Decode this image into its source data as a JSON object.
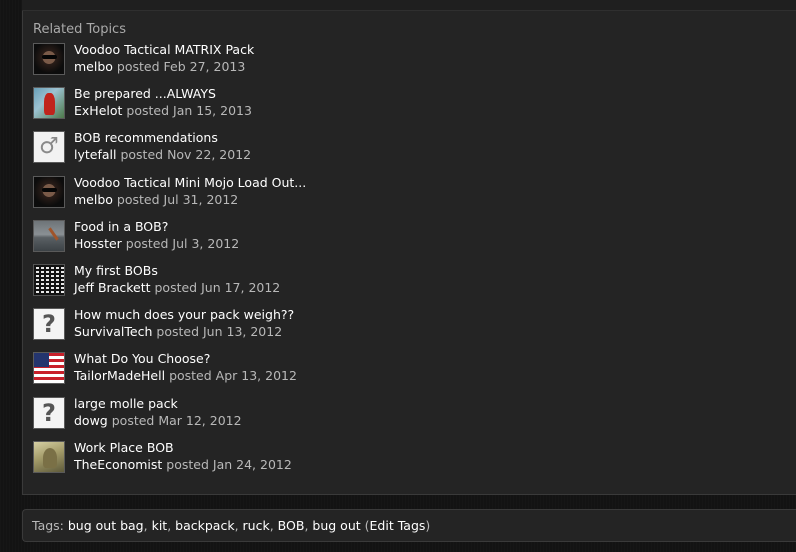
{
  "related": {
    "heading": "Related Topics",
    "posted_word": "posted",
    "topics": [
      {
        "title": "Voodoo Tactical MATRIX Pack",
        "author": "melbo",
        "date": "Feb 27, 2013",
        "avatar": "sunglasses-face-avatar"
      },
      {
        "title": "Be prepared ...ALWAYS",
        "author": "ExHelot",
        "date": "Jan 15, 2013",
        "avatar": "red-figure-avatar"
      },
      {
        "title": "BOB recommendations",
        "author": "lytefall",
        "date": "Nov 22, 2012",
        "avatar": "male-symbol-avatar",
        "glyph": "♂"
      },
      {
        "title": "Voodoo Tactical Mini Mojo Load Out...",
        "author": "melbo",
        "date": "Jul 31, 2012",
        "avatar": "sunglasses-face-avatar"
      },
      {
        "title": "Food in a BOB?",
        "author": "Hosster",
        "date": "Jul 3, 2012",
        "avatar": "water-landscape-avatar"
      },
      {
        "title": "My first BOBs",
        "author": "Jeff Brackett",
        "date": "Jun 17, 2012",
        "avatar": "qr-code-avatar"
      },
      {
        "title": "How much does your pack weigh??",
        "author": "SurvivalTech",
        "date": "Jun 13, 2012",
        "avatar": "question-mark-avatar",
        "glyph": "?"
      },
      {
        "title": "What Do You Choose?",
        "author": "TailorMadeHell",
        "date": "Apr 13, 2012",
        "avatar": "us-flag-avatar"
      },
      {
        "title": "large molle pack",
        "author": "dowg",
        "date": "Mar 12, 2012",
        "avatar": "question-mark-avatar",
        "glyph": "?"
      },
      {
        "title": "Work Place BOB",
        "author": "TheEconomist",
        "date": "Jan 24, 2012",
        "avatar": "soldier-avatar"
      }
    ]
  },
  "tags": {
    "label": "Tags:",
    "items": [
      "bug out bag",
      "kit",
      "backpack",
      "ruck",
      "BOB",
      "bug out"
    ],
    "edit_label": "Edit Tags"
  },
  "colors": {
    "page_bg": "#131313",
    "panel_bg": "#242424",
    "heading_text": "#a9a9a9",
    "link_text": "#ffffff",
    "meta_text": "#b8b8b8"
  }
}
